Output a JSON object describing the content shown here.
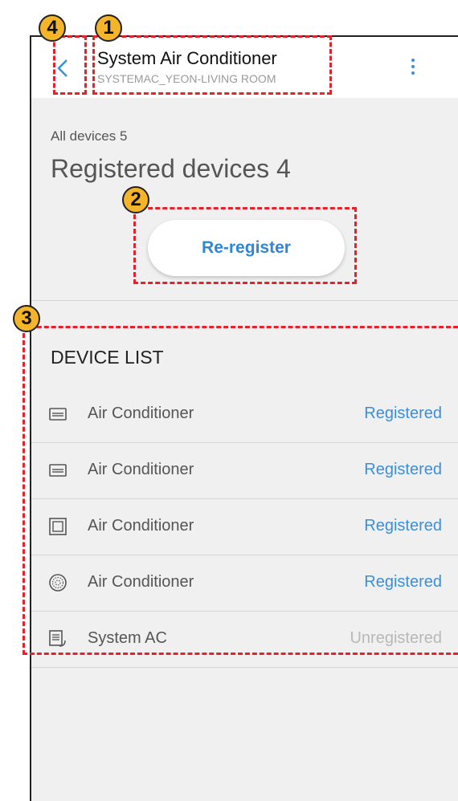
{
  "header": {
    "title": "System Air Conditioner",
    "subtitle": "SYSTEMAC_YEON-LIVING ROOM",
    "back_icon": "chevron-left-icon",
    "menu_icon": "more-vertical-icon"
  },
  "summary": {
    "all_devices": "All devices 5",
    "registered": "Registered devices 4"
  },
  "reregister_label": "Re-register",
  "device_list": {
    "title": "DEVICE LIST",
    "items": [
      {
        "name": "Air Conditioner",
        "status": "Registered",
        "icon": "ac-wall-icon"
      },
      {
        "name": "Air Conditioner",
        "status": "Registered",
        "icon": "ac-wall-icon"
      },
      {
        "name": "Air Conditioner",
        "status": "Registered",
        "icon": "ac-cassette-icon"
      },
      {
        "name": "Air Conditioner",
        "status": "Registered",
        "icon": "ac-round-icon"
      },
      {
        "name": "System AC",
        "status": "Unregistered",
        "icon": "system-ac-icon"
      }
    ]
  },
  "callouts": [
    "1",
    "2",
    "3",
    "4"
  ],
  "colors": {
    "accent": "#3b8fd8",
    "callout_border": "#e8202a",
    "callout_badge": "#f5b52b",
    "unregistered": "#b8b8b8"
  }
}
